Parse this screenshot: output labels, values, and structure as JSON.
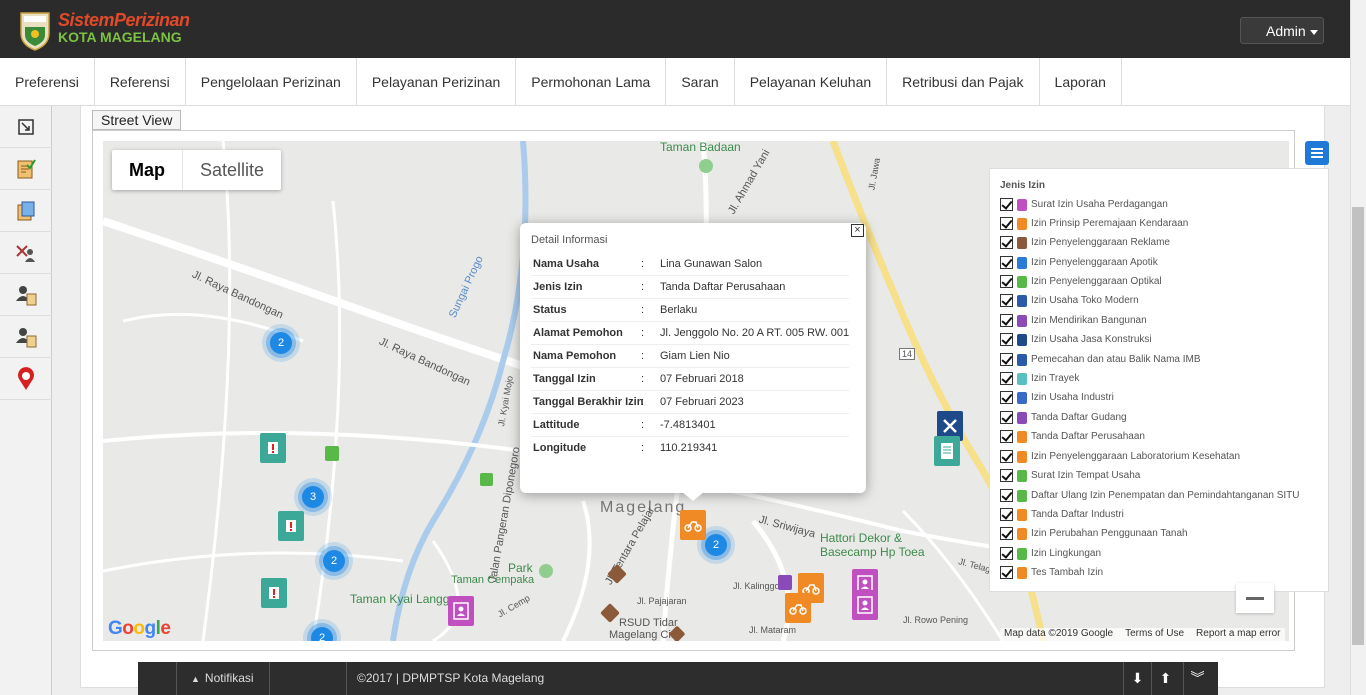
{
  "app": {
    "logo_line1": "SistemPerizinan",
    "logo_line2": "KOTA MAGELANG",
    "user_menu_label": "Admin"
  },
  "nav": {
    "items": [
      {
        "label": "Preferensi"
      },
      {
        "label": "Referensi"
      },
      {
        "label": "Pengelolaan Perizinan"
      },
      {
        "label": "Pelayanan Perizinan"
      },
      {
        "label": "Permohonan Lama"
      },
      {
        "label": "Saran"
      },
      {
        "label": "Pelayanan Keluhan"
      },
      {
        "label": "Retribusi dan Pajak"
      },
      {
        "label": "Laporan"
      }
    ]
  },
  "sidebar": {
    "tools": [
      {
        "icon": "resize-icon"
      },
      {
        "icon": "document-check-icon"
      },
      {
        "icon": "document-copy-icon"
      },
      {
        "icon": "user-tools-icon"
      },
      {
        "icon": "user-document-icon"
      },
      {
        "icon": "user-document-alt-icon"
      },
      {
        "icon": "map-pin-icon"
      }
    ]
  },
  "street_view_tab": "Street View",
  "map": {
    "type_buttons": {
      "map": "Map",
      "satellite": "Satellite"
    },
    "selected_type": "Map",
    "labels": {
      "taman_badaan": "Taman Badaan",
      "jl_raya_bandongan_1": "Jl. Raya Bandongan",
      "jl_raya_bandongan_2": "Jl. Raya Bandongan",
      "sungai_progo": "Sungai Progo",
      "jl_ahmad_yani": "Jl. Ahmad Yani",
      "magelang": "Magelang",
      "park": "Park",
      "taman_cempaka": "Taman Cempaka",
      "taman_kyai_langgeng": "Taman Kyai Langgeng",
      "rsud_tidar": "RSUD Tidar",
      "magelang_city": "Magelang City",
      "hattori": "Hattori Dekor &",
      "basecamp": "Basecamp Hp Toea",
      "jl_diponegoro": "Jalan Pangeran Diponegoro",
      "jl_tentara_pelajar": "Jl. Tentara Pelajar",
      "jl_sriwijaya": "Jl. Sriwijaya",
      "jl_kalinggo": "Jl. Kalinggo",
      "jl_telaga": "Jl. Telaga",
      "jl_rowo_pening": "Jl. Rowo Pening",
      "jl_mataram": "Jl. Mataram",
      "jl_cemp": "Jl. Cemp",
      "jl_pajajaran": "Jl. Pajajaran",
      "jl_kyai_mojo": "Jl. Kyai Mojo",
      "jl_jawa": "Jl. Jawa",
      "road_14": "14"
    },
    "clusters": [
      {
        "count": "2"
      },
      {
        "count": "3"
      },
      {
        "count": "2"
      },
      {
        "count": "2"
      },
      {
        "count": "2"
      }
    ],
    "google_logo": "Google",
    "attribution": {
      "data": "Map data ©2019 Google",
      "terms": "Terms of Use",
      "report": "Report a map error"
    }
  },
  "info_window": {
    "title": "Detail Informasi",
    "rows": [
      {
        "key": "Nama Usaha",
        "sep": ":",
        "value": "Lina Gunawan Salon"
      },
      {
        "key": "Jenis Izin",
        "sep": ":",
        "value": "Tanda Daftar Perusahaan"
      },
      {
        "key": "Status",
        "sep": ":",
        "value": "Berlaku"
      },
      {
        "key": "Alamat Pemohon",
        "sep": ":",
        "value": "Jl. Jenggolo No. 20 A RT. 005 RW. 001"
      },
      {
        "key": "Nama Pemohon",
        "sep": ":",
        "value": "Giam Lien Nio"
      },
      {
        "key": "Tanggal Izin",
        "sep": ":",
        "value": "07 Februari 2018"
      },
      {
        "key": "Tanggal Berakhir Izin",
        "sep": ":",
        "value": "07 Februari 2023"
      },
      {
        "key": "Lattitude",
        "sep": ":",
        "value": "-7.4813401"
      },
      {
        "key": "Longitude",
        "sep": ":",
        "value": "110.219341"
      }
    ],
    "close_label": "×"
  },
  "legend": {
    "title": "Jenis Izin",
    "items": [
      {
        "label": "Surat Izin Usaha Perdagangan",
        "color": "#c050c0",
        "checked": true
      },
      {
        "label": "Izin Prinsip Peremajaan Kendaraan",
        "color": "#f08a24",
        "checked": true
      },
      {
        "label": "Izin Penyelenggaraan Reklame",
        "color": "#8a5a3a",
        "checked": true
      },
      {
        "label": "Izin Penyelenggaraan Apotik",
        "color": "#2a7ad6",
        "checked": true
      },
      {
        "label": "Izin Penyelenggaraan Optikal",
        "color": "#58b848",
        "checked": true
      },
      {
        "label": "Izin Usaha Toko Modern",
        "color": "#2a5aa8",
        "checked": true
      },
      {
        "label": "Izin Mendirikan Bangunan",
        "color": "#8a4ab8",
        "checked": true
      },
      {
        "label": "Izin Usaha Jasa Konstruksi",
        "color": "#1e4a8a",
        "checked": true
      },
      {
        "label": "Pemecahan dan atau Balik Nama IMB",
        "color": "#2a5aa8",
        "checked": true
      },
      {
        "label": "Izin Trayek",
        "color": "#58c0c0",
        "checked": true
      },
      {
        "label": "Izin Usaha Industri",
        "color": "#3a6ac8",
        "checked": true
      },
      {
        "label": "Tanda Daftar Gudang",
        "color": "#8a4ab8",
        "checked": true
      },
      {
        "label": "Tanda Daftar Perusahaan",
        "color": "#f08a24",
        "checked": true
      },
      {
        "label": "Izin Penyelenggaraan Laboratorium Kesehatan",
        "color": "#f08a24",
        "checked": true
      },
      {
        "label": "Surat Izin Tempat Usaha",
        "color": "#58b848",
        "checked": true
      },
      {
        "label": "Daftar Ulang Izin Penempatan dan Pemindahtanganan SITU",
        "color": "#58b848",
        "checked": true
      },
      {
        "label": "Tanda Daftar Industri",
        "color": "#f08a24",
        "checked": true
      },
      {
        "label": "Izin Perubahan Penggunaan Tanah",
        "color": "#f08a24",
        "checked": true
      },
      {
        "label": "Izin Lingkungan",
        "color": "#58b848",
        "checked": true
      },
      {
        "label": "Tes Tambah Izin",
        "color": "#f08a24",
        "checked": true
      }
    ]
  },
  "footer": {
    "notifications_label": "Notifikasi",
    "copyright": "©2017 | DPMPTSP Kota Magelang"
  },
  "colors": {
    "header_bg": "#2b2b2b",
    "cluster_blue": "#1e88e5",
    "logo_red": "#e04a2a",
    "logo_green": "#7cc242"
  }
}
